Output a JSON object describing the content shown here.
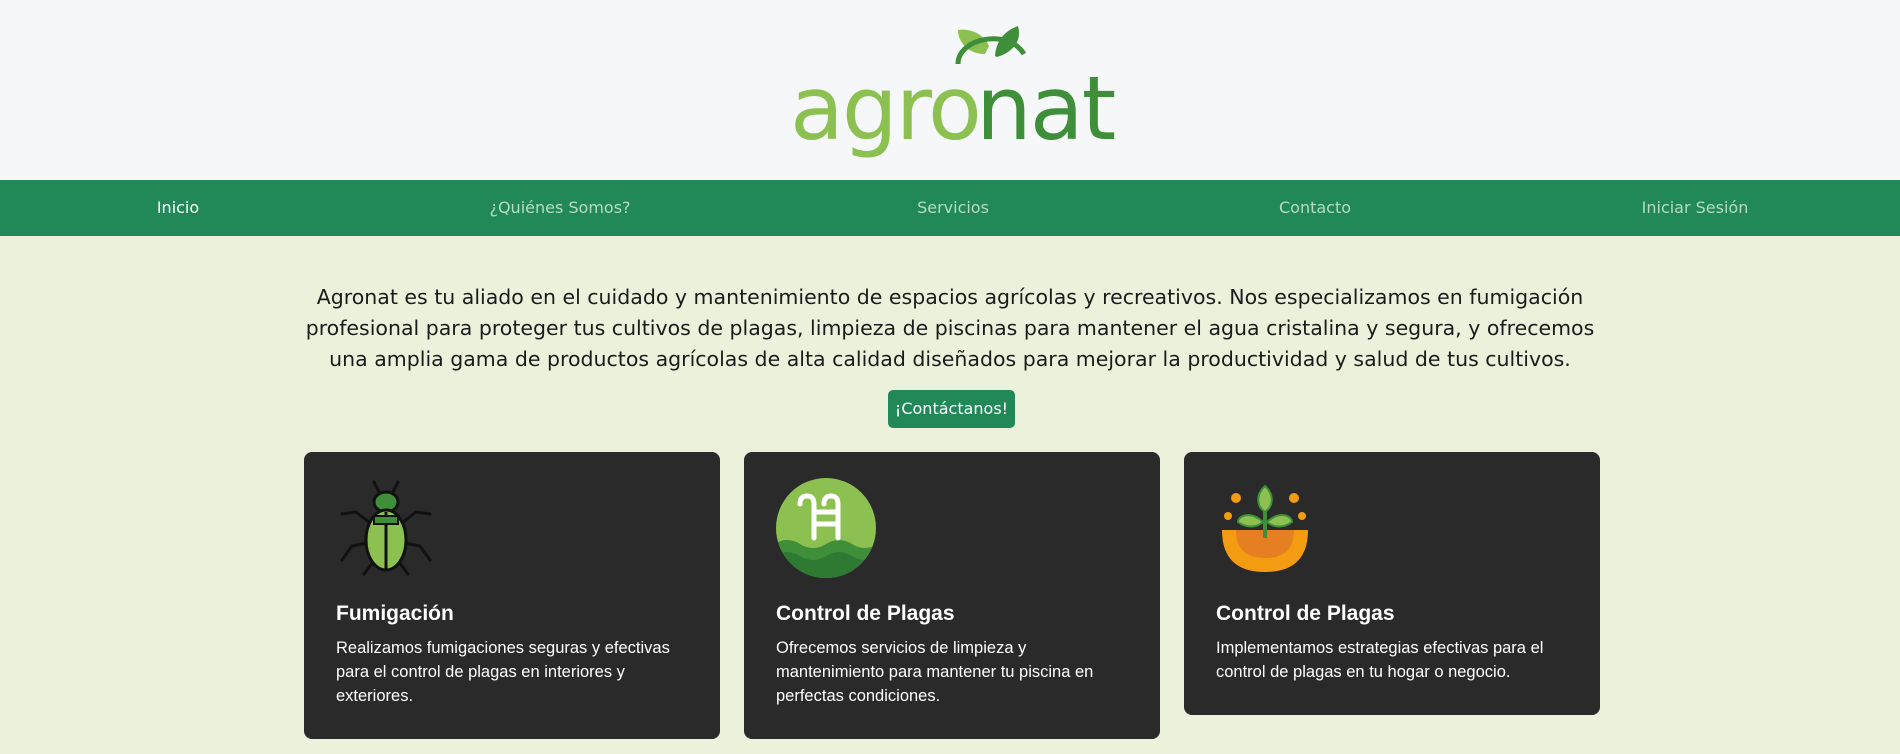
{
  "brand": {
    "logo_text": "agronat"
  },
  "nav": {
    "items": [
      {
        "label": "Inicio"
      },
      {
        "label": "¿Quiénes Somos?"
      },
      {
        "label": "Servicios"
      },
      {
        "label": "Contacto"
      },
      {
        "label": "Iniciar Sesión"
      }
    ],
    "active_index": 0
  },
  "intro": {
    "text": "Agronat es tu aliado en el cuidado y mantenimiento de espacios agrícolas y recreativos. Nos especializamos en fumigación profesional para proteger tus cultivos de plagas, limpieza de piscinas para mantener el agua cristalina y segura, y ofrecemos una amplia gama de productos agrícolas de alta calidad diseñados para mejorar la productividad y salud de tus cultivos."
  },
  "cta": {
    "label": "¡Contáctanos!"
  },
  "cards": [
    {
      "icon": "beetle-icon",
      "title": "Fumigación",
      "desc": "Realizamos fumigaciones seguras y efectivas para el control de plagas en interiores y exteriores."
    },
    {
      "icon": "pool-ladder-icon",
      "title": "Control de Plagas",
      "desc": "Ofrecemos servicios de limpieza y mantenimiento para mantener tu piscina en perfectas condiciones."
    },
    {
      "icon": "plant-bowl-icon",
      "title": "Control de Plagas",
      "desc": "Implementamos estrategias efectivas para el control de plagas en tu hogar o negocio."
    }
  ],
  "colors": {
    "brand_green": "#218857",
    "light_green": "#8cc152",
    "dark_green": "#3f8f3a",
    "card_bg": "#2a2a2a",
    "page_bg": "#ecf1dc"
  }
}
